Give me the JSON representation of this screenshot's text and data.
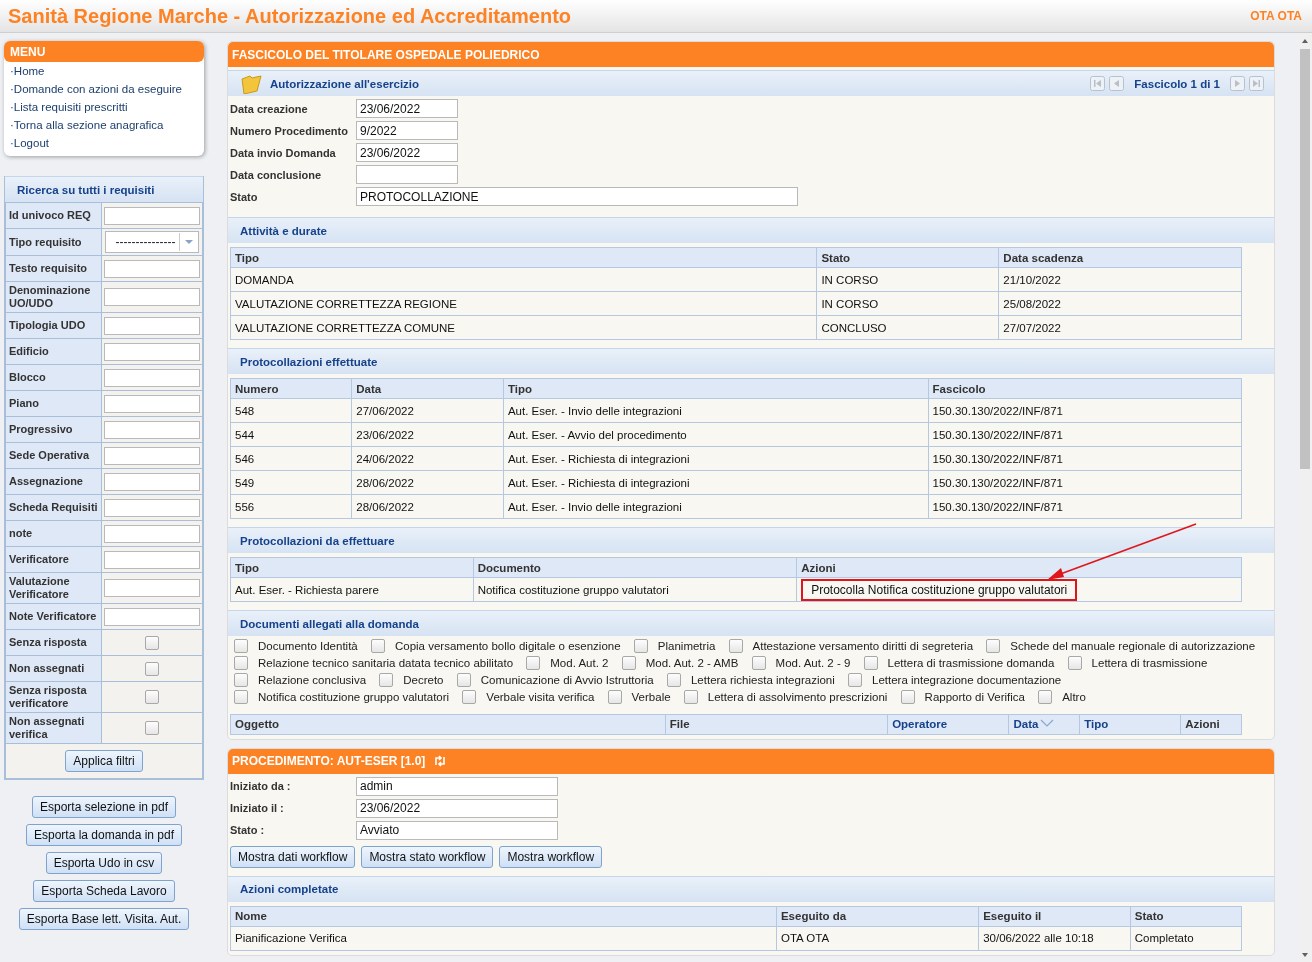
{
  "header": {
    "title": "Sanità Regione Marche - Autorizzazione ed Accreditamento",
    "user": "OTA OTA"
  },
  "menu": {
    "title": "MENU",
    "items": [
      "·Home",
      "·Domande con azioni da eseguire",
      "·Lista requisiti prescritti",
      "·Torna alla sezione anagrafica",
      "·Logout"
    ]
  },
  "search": {
    "title": "Ricerca su tutti i requisiti",
    "fields": [
      {
        "label": "Id univoco REQ",
        "kind": "text"
      },
      {
        "label": "Tipo requisito",
        "kind": "select",
        "value": "---------------"
      },
      {
        "label": "Testo requisito",
        "kind": "text"
      },
      {
        "label": "Denominazione UO/UDO",
        "kind": "text"
      },
      {
        "label": "Tipologia UDO",
        "kind": "text"
      },
      {
        "label": "Edificio",
        "kind": "text"
      },
      {
        "label": "Blocco",
        "kind": "text"
      },
      {
        "label": "Piano",
        "kind": "text"
      },
      {
        "label": "Progressivo",
        "kind": "text"
      },
      {
        "label": "Sede Operativa",
        "kind": "text"
      },
      {
        "label": "Assegnazione",
        "kind": "text"
      },
      {
        "label": "Scheda Requisiti",
        "kind": "text"
      },
      {
        "label": "note",
        "kind": "text"
      },
      {
        "label": "Verificatore",
        "kind": "text"
      },
      {
        "label": "Valutazione Verificatore",
        "kind": "text"
      },
      {
        "label": "Note Verificatore",
        "kind": "text"
      },
      {
        "label": "Senza risposta",
        "kind": "checkbox",
        "checked": false
      },
      {
        "label": "Non assegnati",
        "kind": "checkbox",
        "checked": false
      },
      {
        "label": "Senza risposta verificatore",
        "kind": "checkbox",
        "checked": false
      },
      {
        "label": "Non assegnati verifica",
        "kind": "checkbox",
        "checked": false
      }
    ],
    "apply_button": "Applica filtri"
  },
  "export_buttons": [
    "Esporta selezione in pdf",
    "Esporta la domanda in pdf",
    "Esporta Udo in csv",
    "Esporta Scheda Lavoro",
    "Esporta Base lett. Visita. Aut."
  ],
  "fascicolo": {
    "title": "FASCICOLO DEL TITOLARE OSPEDALE POLIEDRICO",
    "subtitle": "Autorizzazione all'esercizio",
    "pager": "Fascicolo 1 di 1",
    "fields": [
      {
        "label": "Data creazione",
        "value": "23/06/2022"
      },
      {
        "label": "Numero Procedimento",
        "value": "9/2022"
      },
      {
        "label": "Data invio Domanda",
        "value": "23/06/2022"
      },
      {
        "label": "Data conclusione"
      },
      {
        "label": "Stato",
        "value": "PROTOCOLLAZIONE"
      }
    ],
    "sections": [
      {
        "title": "Attività e durate",
        "table": {
          "columns": [
            "Tipo",
            "Stato",
            "Data scadenza"
          ],
          "rows": [
            [
              "DOMANDA",
              "IN CORSO",
              "21/10/2022"
            ],
            [
              "VALUTAZIONE CORRETTEZZA REGIONE",
              "IN CORSO",
              "25/08/2022"
            ],
            [
              "VALUTAZIONE CORRETTEZZA COMUNE",
              "CONCLUSO",
              "27/07/2022"
            ]
          ]
        }
      },
      {
        "title": "Protocollazioni effettuate",
        "table": {
          "columns": [
            "Numero",
            "Data",
            "Tipo",
            "Fascicolo"
          ],
          "rows": [
            [
              "548",
              "27/06/2022",
              "Aut. Eser. - Invio delle integrazioni",
              "150.30.130/2022/INF/871"
            ],
            [
              "544",
              "23/06/2022",
              "Aut. Eser. - Avvio del procedimento",
              "150.30.130/2022/INF/871"
            ],
            [
              "546",
              "24/06/2022",
              "Aut. Eser. - Richiesta di integrazioni",
              "150.30.130/2022/INF/871"
            ],
            [
              "549",
              "28/06/2022",
              "Aut. Eser. - Richiesta di integrazioni",
              "150.30.130/2022/INF/871"
            ],
            [
              "556",
              "28/06/2022",
              "Aut. Eser. - Invio delle integrazioni",
              "150.30.130/2022/INF/871"
            ]
          ]
        }
      },
      {
        "title": "Protocollazioni da effettuare",
        "table": {
          "columns": [
            "Tipo",
            "Documento",
            "Azioni"
          ],
          "rows": [
            [
              "Aut. Eser. - Richiesta parere",
              "Notifica costituzione gruppo valutatori",
              {
                "button": "Protocolla Notifica costituzione gruppo valutatori",
                "highlighted": true
              }
            ]
          ]
        }
      },
      {
        "title": "Documenti allegati alla domanda",
        "checkboxes": [
          {
            "label": "Documento Identità",
            "checked": false
          },
          {
            "label": "Copia versamento bollo digitale o esenzione",
            "checked": false
          },
          {
            "label": "Planimetria",
            "checked": false
          },
          {
            "label": "Attestazione versamento diritti di segreteria",
            "checked": false
          },
          {
            "label": "Schede del manuale regionale di autorizzazione",
            "checked": false
          },
          {
            "label": "Relazione tecnico sanitaria datata tecnico abilitato",
            "checked": false
          },
          {
            "label": "Mod. Aut. 2",
            "checked": false
          },
          {
            "label": "Mod. Aut. 2 - AMB",
            "checked": false
          },
          {
            "label": "Mod. Aut. 2 - 9",
            "checked": false
          },
          {
            "label": "Lettera di trasmissione domanda",
            "checked": false
          },
          {
            "label": "Lettera di trasmissione",
            "checked": false
          },
          {
            "label": "Relazione conclusiva",
            "checked": false
          },
          {
            "label": "Decreto",
            "checked": false
          },
          {
            "label": "Comunicazione di Avvio Istruttoria",
            "checked": false
          },
          {
            "label": "Lettera richiesta integrazioni",
            "checked": false
          },
          {
            "label": "Lettera integrazione documentazione",
            "checked": false
          },
          {
            "label": "Notifica costituzione gruppo valutatori",
            "checked": false
          },
          {
            "label": "Verbale visita verifica",
            "checked": false
          },
          {
            "label": "Verbale",
            "checked": false
          },
          {
            "label": "Lettera di assolvimento prescrizioni",
            "checked": false
          },
          {
            "label": "Rapporto di Verifica",
            "checked": false
          },
          {
            "label": "Altro",
            "checked": false
          }
        ],
        "table": {
          "columns": [
            "Oggetto",
            "File",
            {
              "label": "Operatore",
              "link": true
            },
            {
              "label": "Data",
              "link": true,
              "sorted": true
            },
            {
              "label": "Tipo",
              "link": true
            },
            "Azioni"
          ]
        }
      }
    ]
  },
  "procedimento": {
    "title": "PROCEDIMENTO: AUT-ESER [1.0]",
    "fields": [
      {
        "label": "Iniziato da :",
        "value": "admin"
      },
      {
        "label": "Iniziato il :",
        "value": "23/06/2022"
      },
      {
        "label": "Stato :",
        "value": "Avviato"
      }
    ],
    "buttons": [
      "Mostra dati workflow",
      "Mostra stato workflow",
      "Mostra workflow"
    ],
    "sections": [
      {
        "title": "Azioni completate",
        "table": {
          "columns": [
            "Nome",
            "Eseguito da",
            "Eseguito il",
            "Stato"
          ],
          "rows": [
            [
              "Pianificazione Verifica",
              "OTA OTA",
              "30/06/2022 alle 10:18",
              "Completato"
            ]
          ]
        }
      }
    ]
  }
}
